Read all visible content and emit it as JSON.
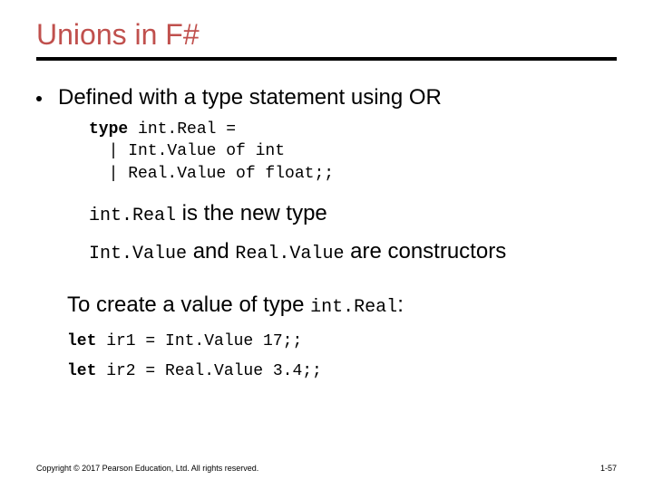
{
  "title": "Unions in F#",
  "bullet": "Defined with a type statement using OR",
  "code": {
    "kw_type": "type",
    "line1_rest": " int.Real =",
    "line2": "  | Int.Value of int",
    "line3": "  | Real.Value of float;;"
  },
  "sub1": {
    "mono1": "int.Real",
    "text1": " is the new type"
  },
  "sub2": {
    "mono1": "Int.Value",
    "text1": " and ",
    "mono2": "Real.Value",
    "text2": " are constructors"
  },
  "create": {
    "text1": "To create a value of type ",
    "mono1": "int.Real",
    "text2": ":"
  },
  "let1": {
    "kw": "let",
    "rest": " ir1 = Int.Value 17;;"
  },
  "let2": {
    "kw": "let",
    "rest": " ir2 = Real.Value 3.4;;"
  },
  "footer": {
    "copyright": "Copyright © 2017 Pearson Education, Ltd. All rights reserved.",
    "page": "1-57"
  }
}
